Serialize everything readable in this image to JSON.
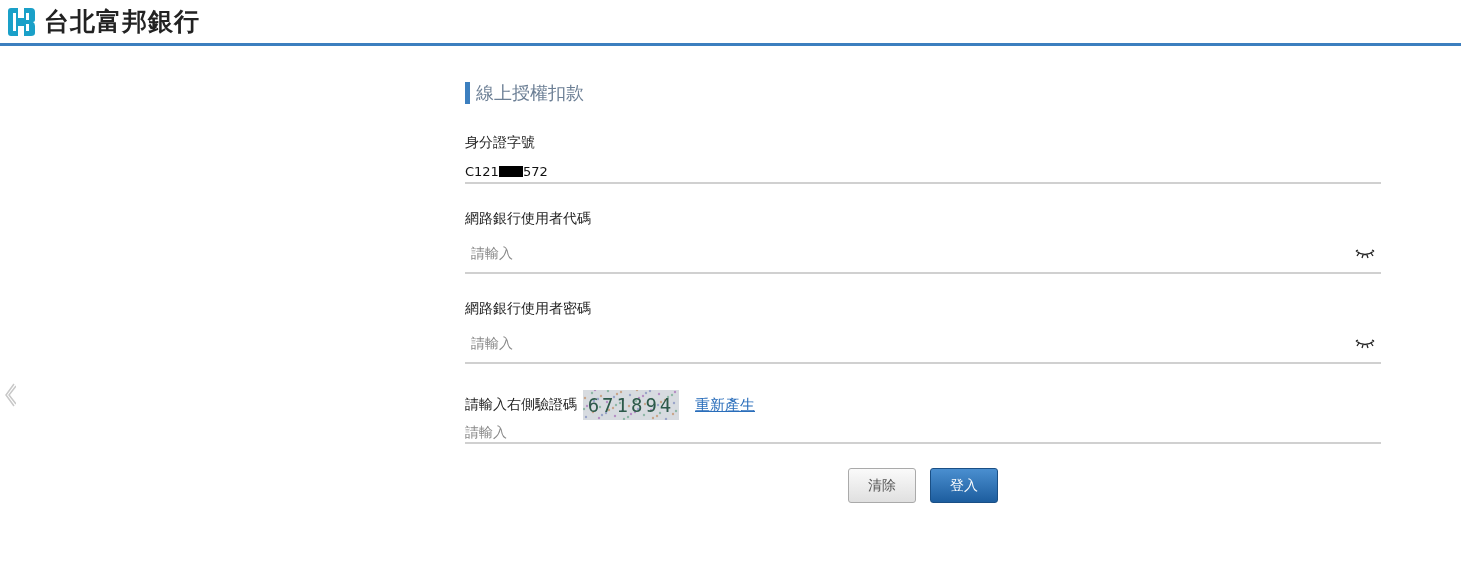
{
  "header": {
    "bank_name": "台北富邦銀行"
  },
  "form": {
    "title": "線上授權扣款",
    "fields": [
      {
        "kind": "masked",
        "label": "身分證字號",
        "value_start": "C121",
        "value_end": "572"
      },
      {
        "kind": "secret",
        "label": "網路銀行使用者代碼",
        "placeholder": "請輸入"
      },
      {
        "kind": "secret",
        "label": "網路銀行使用者密碼",
        "placeholder": "請輸入"
      },
      {
        "kind": "captcha",
        "label": "請輸入右側驗證碼",
        "captcha_code": "671894",
        "refresh_link": "重新產生",
        "placeholder": "請輸入"
      }
    ],
    "buttons": [
      {
        "label": "清除",
        "kind": "secondary"
      },
      {
        "label": "登入",
        "kind": "primary"
      }
    ]
  }
}
